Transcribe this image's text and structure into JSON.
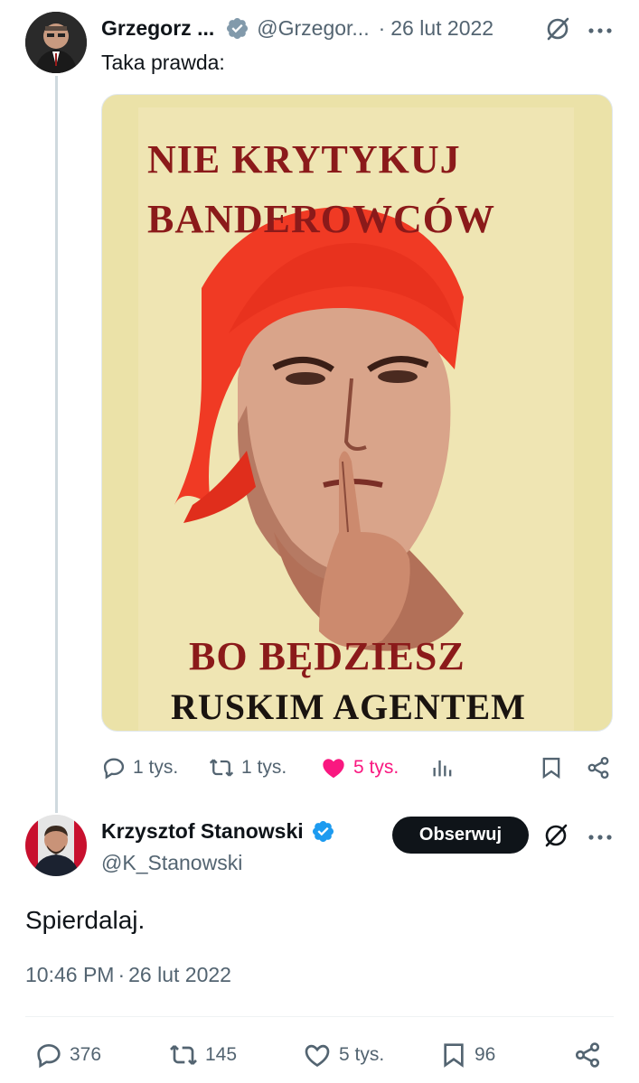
{
  "tweet1": {
    "author_name": "Grzegorz ...",
    "author_handle": "@Grzegor...",
    "separator": "·",
    "date": "26 lut 2022",
    "text": "Taka prawda:",
    "poster": {
      "line1": "NIE KRYTYKUJ",
      "line2": "BANDEROWCÓW",
      "line3": "BO BĘDZIESZ",
      "line4": "RUSKIM AGENTEM"
    },
    "actions": {
      "replies": "1 tys.",
      "retweets": "1 tys.",
      "likes": "5 tys."
    }
  },
  "tweet2": {
    "author_name": "Krzysztof Stanowski",
    "author_handle": "@K_Stanowski",
    "follow_label": "Obserwuj",
    "text": "Spierdalaj.",
    "time": "10:46 PM",
    "separator": "·",
    "date": "26 lut 2022",
    "actions": {
      "replies": "376",
      "retweets": "145",
      "likes": "5 tys.",
      "bookmarks": "96"
    }
  },
  "colors": {
    "text": "#0f1419",
    "secondary": "#536471",
    "verified": "#1d9bf0",
    "like": "#f91880",
    "thread_line": "#cfd9de",
    "poster_red": "#8b1a1a",
    "poster_bg": "#efe5b3"
  },
  "icons": [
    "verified-badge-icon",
    "grok-icon",
    "more-icon",
    "reply-icon",
    "retweet-icon",
    "like-icon",
    "views-icon",
    "bookmark-icon",
    "share-icon"
  ]
}
